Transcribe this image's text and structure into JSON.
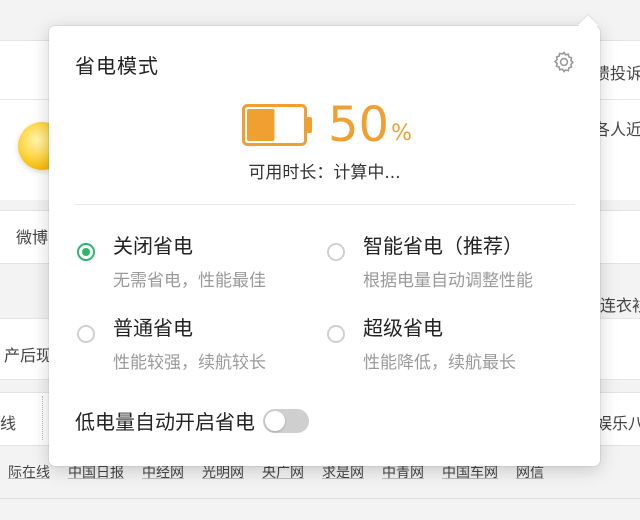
{
  "background": {
    "right_fragments": [
      "馈投诉",
      "各人近",
      "连衣衫"
    ],
    "left_fragments": [
      "微博",
      "产后现",
      "线"
    ],
    "right_ent": "娱乐八",
    "links": [
      "际在线",
      "中国日报",
      "中经网",
      "光明网",
      "央广网",
      "求是网",
      "中青网",
      "中国车网",
      "网信"
    ]
  },
  "popup": {
    "title": "省电模式",
    "settings_icon": "gear-icon",
    "battery": {
      "percent": 50,
      "percent_text": "50",
      "unit": "%",
      "color": "#f0a030"
    },
    "duration": {
      "label": "可用时长",
      "separator": "：",
      "value": "计算中..."
    },
    "modes": [
      {
        "name": "关闭省电",
        "desc": "无需省电，性能最佳",
        "selected": true
      },
      {
        "name": "智能省电（推荐）",
        "desc": "根据电量自动调整性能",
        "selected": false
      },
      {
        "name": "普通省电",
        "desc": "性能较强，续航较长",
        "selected": false
      },
      {
        "name": "超级省电",
        "desc": "性能降低，续航最长",
        "selected": false
      }
    ],
    "auto_low_battery": {
      "label": "低电量自动开启省电",
      "enabled": false
    },
    "accent_color": "#2fb46e"
  }
}
